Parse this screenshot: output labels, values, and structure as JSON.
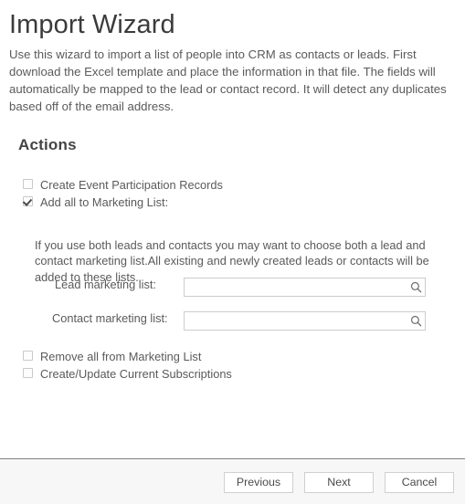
{
  "page": {
    "title": "Import Wizard",
    "intro": "Use this wizard to import a list of people into CRM as contacts or leads. First download the Excel template and place the information in that file. The fields will automatically be mapped to the lead or contact record. It will detect any duplicates based off of the email address."
  },
  "actions": {
    "heading": "Actions",
    "checkboxes": [
      {
        "label": "Create Event Participation Records",
        "checked": false
      },
      {
        "label": "Add all to Marketing List:",
        "checked": true
      },
      {
        "label": "Remove all from Marketing List",
        "checked": false
      },
      {
        "label": "Create/Update Current Subscriptions",
        "checked": false
      }
    ],
    "sub_paragraph": "If you use both leads and contacts you may want to choose both a lead and contact marketing list.All existing and newly created leads or contacts will be added to these lists.",
    "fields": [
      {
        "label": "Lead marketing list:",
        "value": "",
        "placeholder": "",
        "lookup_icon": "search-icon"
      },
      {
        "label": "Contact marketing list:",
        "value": "",
        "placeholder": "",
        "lookup_icon": "search-icon"
      }
    ]
  },
  "footer": {
    "buttons": [
      {
        "label": "Previous"
      },
      {
        "label": "Next"
      },
      {
        "label": "Cancel"
      }
    ]
  },
  "colors": {
    "title_text": "#3b3b3b",
    "body_text": "#5a5a5a",
    "heading_text": "#444444",
    "border": "#cccccc",
    "footer_background": "#f7f7f7",
    "divider": "#808080"
  }
}
